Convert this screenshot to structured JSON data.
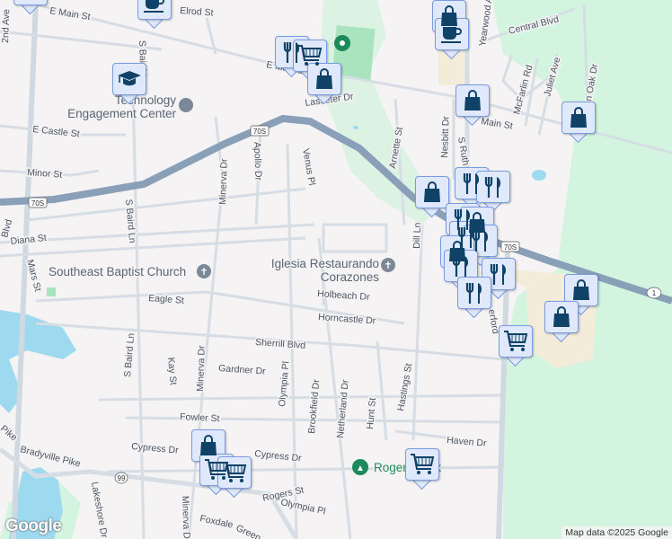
{
  "map": {
    "streets": {
      "e_main_st": "E Main St",
      "e_main_st_2": "E Main St",
      "main_st": "Main St",
      "elrod_st": "Elrod St",
      "central_blvd": "Central Blvd",
      "second_ave": "2nd Ave",
      "lasseter_dr": "Lasseter Dr",
      "e_castle_st": "E Castle St",
      "minor_st": "Minor St",
      "diana_st": "Diana St",
      "blvd": "Blvd",
      "mars_st": "Mars St",
      "s_baird_ln": "S Baird Ln",
      "s_baird_ln_2": "S Baird Ln",
      "s_baird_ln_3": "S Baird Ln",
      "minerva_dr": "Minerva Dr",
      "minerva_dr_2": "Minerva Dr",
      "minerva_dr_3": "Minerva Dr",
      "apollo_dr": "Apollo Dr",
      "venus_pl": "Venus Pl",
      "arnette_st": "Arnette St",
      "nesbitt_dr": "Nesbitt Dr",
      "s_rutherford": "S Ruth",
      "rutherford_lower": "erford",
      "yearwood": "Yearwood A",
      "mcfarlin_rd": "McFarlin Rd",
      "juliet_ave": "Juliet Ave",
      "oak_dr": "n Oak Dr",
      "dill_ln": "Dill Ln",
      "eagle_st": "Eagle St",
      "holbeach_dr": "Holbeach Dr",
      "horncastle_dr": "Horncastle Dr",
      "sherrill_blvd": "Sherrill Blvd",
      "gardner_dr": "Gardner Dr",
      "kay_st": "Kay St",
      "olympia_pl": "Olympia Pl",
      "olympia_pl_2": "Olympia Pl",
      "brookfield_dr": "Brookfield Dr",
      "netherland_dr": "Netherland Dr",
      "hunt_st": "Hunt St",
      "hastings_st": "Hastings St",
      "fowler_st": "Fowler St",
      "cypress_dr": "Cypress Dr",
      "cypress_dr_2": "Cypress Dr",
      "haven_dr": "Haven Dr",
      "bradyville_pike": "Bradyville Pike",
      "pike": "Pike",
      "lakeshore_dr": "Lakeshore Dr",
      "rogers_st": "Rogers St",
      "foxdale": "Foxdale",
      "green": "Green"
    },
    "route_shields": {
      "us70s": "70S",
      "us70s_2": "70S",
      "us70s_3": "70S",
      "tn1": "1",
      "sr99": "99"
    },
    "pois": {
      "technology_center": "Technology Engagement Center",
      "southeast_baptist": "Southeast Baptist Church",
      "iglesia": "Iglesia Restaurando Corazones",
      "rogers_park": "Rogers Park"
    },
    "markers": [
      "cafe",
      "shopping",
      "graduation-cap",
      "restaurant",
      "shopping-cart",
      "shopping",
      "shopping",
      "cafe",
      "shopping",
      "shopping",
      "shopping",
      "restaurant",
      "restaurant",
      "restaurant",
      "shopping",
      "restaurant",
      "restaurant",
      "shopping",
      "restaurant",
      "restaurant",
      "restaurant",
      "shopping",
      "shopping",
      "shopping-cart",
      "shopping",
      "shopping-cart",
      "shopping-cart",
      "shopping-cart"
    ],
    "colors": {
      "marker_fill": "#dfe9fb",
      "marker_icon": "#0f4266",
      "highway": "#8aa0b8",
      "water": "#9dd9ef",
      "park": "#d3f5e0"
    }
  },
  "footer": {
    "logo": "Google",
    "attribution": "Map data ©2025 Google"
  }
}
